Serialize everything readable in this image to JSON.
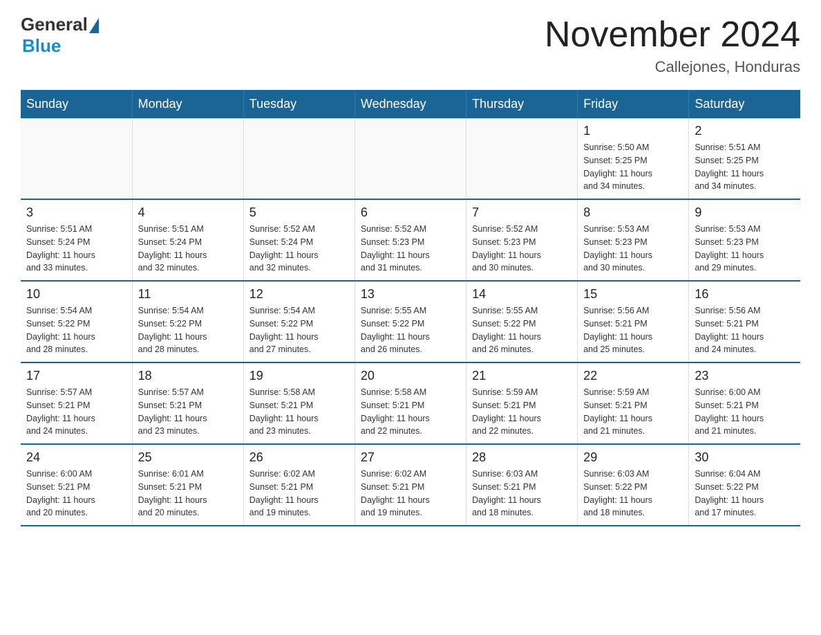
{
  "header": {
    "logo_general": "General",
    "logo_blue": "Blue",
    "main_title": "November 2024",
    "subtitle": "Callejones, Honduras"
  },
  "days_of_week": [
    "Sunday",
    "Monday",
    "Tuesday",
    "Wednesday",
    "Thursday",
    "Friday",
    "Saturday"
  ],
  "weeks": [
    {
      "days": [
        {
          "number": "",
          "info": "",
          "empty": true
        },
        {
          "number": "",
          "info": "",
          "empty": true
        },
        {
          "number": "",
          "info": "",
          "empty": true
        },
        {
          "number": "",
          "info": "",
          "empty": true
        },
        {
          "number": "",
          "info": "",
          "empty": true
        },
        {
          "number": "1",
          "info": "Sunrise: 5:50 AM\nSunset: 5:25 PM\nDaylight: 11 hours\nand 34 minutes."
        },
        {
          "number": "2",
          "info": "Sunrise: 5:51 AM\nSunset: 5:25 PM\nDaylight: 11 hours\nand 34 minutes."
        }
      ]
    },
    {
      "days": [
        {
          "number": "3",
          "info": "Sunrise: 5:51 AM\nSunset: 5:24 PM\nDaylight: 11 hours\nand 33 minutes."
        },
        {
          "number": "4",
          "info": "Sunrise: 5:51 AM\nSunset: 5:24 PM\nDaylight: 11 hours\nand 32 minutes."
        },
        {
          "number": "5",
          "info": "Sunrise: 5:52 AM\nSunset: 5:24 PM\nDaylight: 11 hours\nand 32 minutes."
        },
        {
          "number": "6",
          "info": "Sunrise: 5:52 AM\nSunset: 5:23 PM\nDaylight: 11 hours\nand 31 minutes."
        },
        {
          "number": "7",
          "info": "Sunrise: 5:52 AM\nSunset: 5:23 PM\nDaylight: 11 hours\nand 30 minutes."
        },
        {
          "number": "8",
          "info": "Sunrise: 5:53 AM\nSunset: 5:23 PM\nDaylight: 11 hours\nand 30 minutes."
        },
        {
          "number": "9",
          "info": "Sunrise: 5:53 AM\nSunset: 5:23 PM\nDaylight: 11 hours\nand 29 minutes."
        }
      ]
    },
    {
      "days": [
        {
          "number": "10",
          "info": "Sunrise: 5:54 AM\nSunset: 5:22 PM\nDaylight: 11 hours\nand 28 minutes."
        },
        {
          "number": "11",
          "info": "Sunrise: 5:54 AM\nSunset: 5:22 PM\nDaylight: 11 hours\nand 28 minutes."
        },
        {
          "number": "12",
          "info": "Sunrise: 5:54 AM\nSunset: 5:22 PM\nDaylight: 11 hours\nand 27 minutes."
        },
        {
          "number": "13",
          "info": "Sunrise: 5:55 AM\nSunset: 5:22 PM\nDaylight: 11 hours\nand 26 minutes."
        },
        {
          "number": "14",
          "info": "Sunrise: 5:55 AM\nSunset: 5:22 PM\nDaylight: 11 hours\nand 26 minutes."
        },
        {
          "number": "15",
          "info": "Sunrise: 5:56 AM\nSunset: 5:21 PM\nDaylight: 11 hours\nand 25 minutes."
        },
        {
          "number": "16",
          "info": "Sunrise: 5:56 AM\nSunset: 5:21 PM\nDaylight: 11 hours\nand 24 minutes."
        }
      ]
    },
    {
      "days": [
        {
          "number": "17",
          "info": "Sunrise: 5:57 AM\nSunset: 5:21 PM\nDaylight: 11 hours\nand 24 minutes."
        },
        {
          "number": "18",
          "info": "Sunrise: 5:57 AM\nSunset: 5:21 PM\nDaylight: 11 hours\nand 23 minutes."
        },
        {
          "number": "19",
          "info": "Sunrise: 5:58 AM\nSunset: 5:21 PM\nDaylight: 11 hours\nand 23 minutes."
        },
        {
          "number": "20",
          "info": "Sunrise: 5:58 AM\nSunset: 5:21 PM\nDaylight: 11 hours\nand 22 minutes."
        },
        {
          "number": "21",
          "info": "Sunrise: 5:59 AM\nSunset: 5:21 PM\nDaylight: 11 hours\nand 22 minutes."
        },
        {
          "number": "22",
          "info": "Sunrise: 5:59 AM\nSunset: 5:21 PM\nDaylight: 11 hours\nand 21 minutes."
        },
        {
          "number": "23",
          "info": "Sunrise: 6:00 AM\nSunset: 5:21 PM\nDaylight: 11 hours\nand 21 minutes."
        }
      ]
    },
    {
      "days": [
        {
          "number": "24",
          "info": "Sunrise: 6:00 AM\nSunset: 5:21 PM\nDaylight: 11 hours\nand 20 minutes."
        },
        {
          "number": "25",
          "info": "Sunrise: 6:01 AM\nSunset: 5:21 PM\nDaylight: 11 hours\nand 20 minutes."
        },
        {
          "number": "26",
          "info": "Sunrise: 6:02 AM\nSunset: 5:21 PM\nDaylight: 11 hours\nand 19 minutes."
        },
        {
          "number": "27",
          "info": "Sunrise: 6:02 AM\nSunset: 5:21 PM\nDaylight: 11 hours\nand 19 minutes."
        },
        {
          "number": "28",
          "info": "Sunrise: 6:03 AM\nSunset: 5:21 PM\nDaylight: 11 hours\nand 18 minutes."
        },
        {
          "number": "29",
          "info": "Sunrise: 6:03 AM\nSunset: 5:22 PM\nDaylight: 11 hours\nand 18 minutes."
        },
        {
          "number": "30",
          "info": "Sunrise: 6:04 AM\nSunset: 5:22 PM\nDaylight: 11 hours\nand 17 minutes."
        }
      ]
    }
  ]
}
